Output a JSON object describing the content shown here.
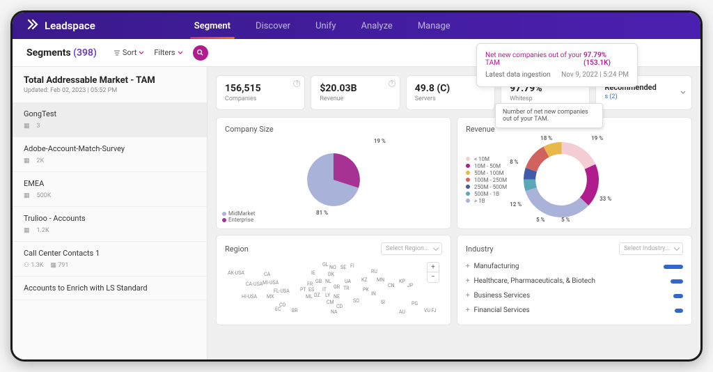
{
  "brand": "Leadspace",
  "nav": {
    "segment": "Segment",
    "discover": "Discover",
    "unify": "Unify",
    "analyze": "Analyze",
    "manage": "Manage"
  },
  "subbar": {
    "title_prefix": "Segments",
    "count": "(398)",
    "sort": "Sort",
    "filters": "Filters"
  },
  "popover": {
    "row1_label": "Net new companies out of your TAM",
    "row1_val": "97.79% (153.1K)",
    "row2_label": "Latest data ingestion",
    "row2_val": "Nov 9, 2022 | 5:24 PM"
  },
  "sidebar": {
    "title": "Total Addressable Market - TAM",
    "updated": "Updated: Feb 02, 2023 | 05:52 PM",
    "items": [
      {
        "name": "GongTest",
        "meta1": "3",
        "meta2": ""
      },
      {
        "name": "Adobe-Account-Match-Survey",
        "meta1": "2K",
        "meta2": ""
      },
      {
        "name": "EMEA",
        "meta1": "500K",
        "meta2": ""
      },
      {
        "name": "Trulioo - Accounts",
        "meta1": "1.2K",
        "meta2": ""
      },
      {
        "name": "Call Center Contacts 1",
        "meta1": "1.3K",
        "meta2": "791"
      },
      {
        "name": "Accounts to Enrich with LS Standard",
        "meta1": "",
        "meta2": ""
      }
    ]
  },
  "kpis": {
    "k1": {
      "val": "156,515",
      "label": "Companies"
    },
    "k2": {
      "val": "$20.03B",
      "label": "Revenue"
    },
    "k3": {
      "val": "49.8 (C)",
      "label": "Servers"
    },
    "k4": {
      "val": "97.79%",
      "label": "Whitesp"
    },
    "rec": {
      "title": "Recommended",
      "sub": "s (2)"
    }
  },
  "tooltip": "Number of net new companies out of your TAM.",
  "panels": {
    "company_size": "Company Size",
    "revenue": "Revenue",
    "region": "Region",
    "industry": "Industry",
    "region_select": "Select Region...",
    "industry_select": "Select Industry..."
  },
  "company_size_legend": {
    "a": "MidMarket",
    "b": "Enterprise"
  },
  "company_size_labels": {
    "a": "81 %",
    "b": "19 %"
  },
  "revenue_legend": [
    "< 10M",
    "10M - 50M",
    "50M - 100M",
    "100M - 250M",
    "250M - 500M",
    "500M - 1B",
    "> 1B"
  ],
  "revenue_labels": {
    "l1": "18 %",
    "l2": "19 %",
    "l3": "8 %",
    "l4": "33 %",
    "l5": "12 %",
    "l6": "5 %",
    "l7": "5 %"
  },
  "map_labels": [
    "AK-USA",
    "CA",
    "GL",
    "IE",
    "GB",
    "FR",
    "NO",
    "SE",
    "FI",
    "RU",
    "PT",
    "ES",
    "IT",
    "DZ",
    "NL",
    "UA",
    "KZ",
    "MN",
    "CN",
    "JP",
    "KP",
    "HI-USA",
    "MI-USA",
    "FL-USA",
    "CA-USA",
    "MX",
    "IN",
    "LY",
    "EC",
    "BR",
    "AU",
    "PG",
    "CD",
    "PK",
    "SI",
    "CO",
    "DK",
    "GR",
    "TR",
    "NA",
    "VU FJ",
    "CM",
    "ML",
    "NE",
    "SO"
  ],
  "industries": [
    "Manufacturing",
    "Healthcare, Pharmaceuticals, & Biotech",
    "Business Services",
    "Financial Services"
  ],
  "chart_data": [
    {
      "type": "pie",
      "title": "Company Size",
      "series": [
        {
          "name": "MidMarket",
          "value": 81,
          "color": "#a9b2d8"
        },
        {
          "name": "Enterprise",
          "value": 19,
          "color": "#a63393"
        }
      ]
    },
    {
      "type": "pie",
      "title": "Revenue",
      "donut": true,
      "series": [
        {
          "name": "< 10M",
          "value": 18,
          "color": "#f4cdd5"
        },
        {
          "name": "10M - 50M",
          "value": 19,
          "color": "#b01c8e"
        },
        {
          "name": "50M - 100M",
          "value": 8,
          "color": "#e8b94a"
        },
        {
          "name": "100M - 250M",
          "value": 33,
          "color": "#a9b2d8"
        },
        {
          "name": "250M - 500M",
          "value": 12,
          "color": "#d0625f"
        },
        {
          "name": "500M - 1B",
          "value": 5,
          "color": "#5aa8b8"
        },
        {
          "name": "> 1B",
          "value": 5,
          "color": "#3f5ba9"
        }
      ]
    }
  ]
}
